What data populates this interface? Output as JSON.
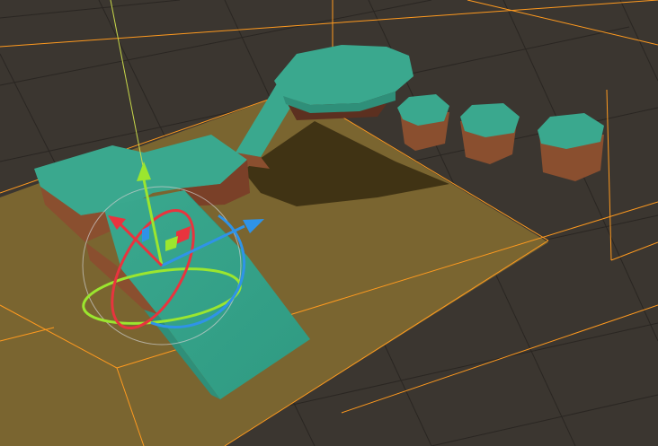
{
  "viewport": {
    "label": "",
    "view": "3D scene view",
    "colors": {
      "background": "#3b3630",
      "grid_line": "#2a2622",
      "bounds_outline": "#ff9a1f",
      "ground_plane": "#7a6530",
      "grass_top": "#3aa88e",
      "grass_side": "#2f8f79",
      "dirt": "#8a4f2f",
      "dirt_dark": "#5c3020",
      "shadow": "#3a2e12"
    },
    "objects": [
      {
        "name": "ground-plane",
        "kind": "plane"
      },
      {
        "name": "main-platform",
        "kind": "grass-block"
      },
      {
        "name": "ramp",
        "kind": "grass-slope"
      },
      {
        "name": "bridge",
        "kind": "grass-path"
      },
      {
        "name": "round-platform",
        "kind": "grass-octagon"
      },
      {
        "name": "pillar-1",
        "kind": "grass-pillar"
      },
      {
        "name": "pillar-2",
        "kind": "grass-pillar"
      },
      {
        "name": "pillar-3",
        "kind": "grass-pillar"
      }
    ],
    "gizmo": {
      "tool": "rotate-move",
      "x_axis_color": "#e8343e",
      "y_axis_color": "#9be62f",
      "z_axis_color": "#2f93e8"
    }
  }
}
